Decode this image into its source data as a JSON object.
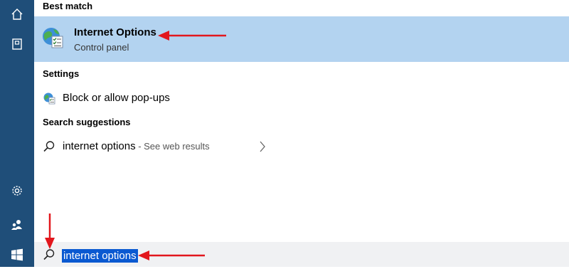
{
  "rail": {
    "items": [
      "home-icon",
      "notebook-icon",
      "settings-icon",
      "people-icon",
      "windows-start-icon"
    ]
  },
  "best_match": {
    "header": "Best match",
    "title": "Internet Options",
    "subtitle": "Control panel"
  },
  "settings": {
    "header": "Settings",
    "items": [
      {
        "label": "Block or allow pop-ups",
        "icon": "internet-options-small-icon"
      }
    ]
  },
  "suggestions": {
    "header": "Search suggestions",
    "items": [
      {
        "query": "internet options",
        "hint": " - See web results",
        "icon": "search-icon"
      }
    ]
  },
  "search": {
    "value": "internet options"
  },
  "colors": {
    "rail": "#1f4e79",
    "highlight_row": "#b3d3f0",
    "selection": "#0a59d1",
    "annotation_arrow": "#e2171d"
  }
}
